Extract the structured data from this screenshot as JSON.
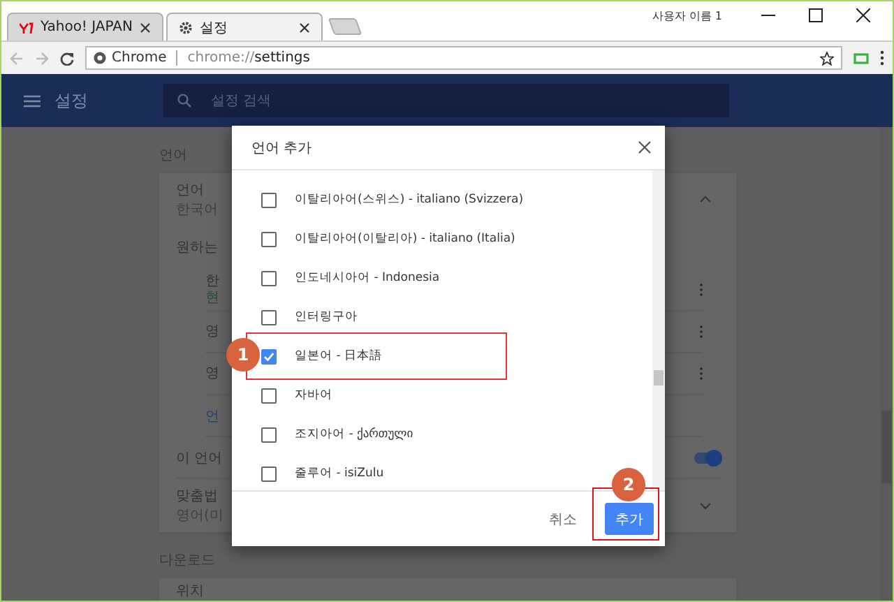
{
  "window": {
    "profile": "사용자 이름 1"
  },
  "tabs": [
    {
      "title": "Yahoo! JAPAN",
      "selected": false
    },
    {
      "title": "설정",
      "selected": true
    }
  ],
  "address_bar": {
    "site": "Chrome",
    "url_scheme": "chrome://",
    "url_path": "settings"
  },
  "header": {
    "title": "설정",
    "search_placeholder": "설정 검색"
  },
  "sections": [
    {
      "title": "언어",
      "rows": [
        {
          "kind": "expander",
          "title": "언어",
          "subtitle": "한국어",
          "expanded": true
        },
        {
          "kind": "prompt",
          "title": "원하는"
        },
        {
          "kind": "language",
          "title": "한",
          "note": "현"
        },
        {
          "kind": "language",
          "title": "영"
        },
        {
          "kind": "language",
          "title": "영"
        },
        {
          "kind": "link",
          "title": "언"
        },
        {
          "kind": "toggle",
          "title": "이 언어",
          "on": true
        },
        {
          "kind": "expander",
          "title": "맞춤법",
          "subtitle": "영어(미",
          "expanded": false
        }
      ]
    },
    {
      "title": "다운로드",
      "rows": [
        {
          "kind": "plain",
          "title": "위치"
        }
      ]
    }
  ],
  "dialog": {
    "title": "언어 추가",
    "items": [
      {
        "label": "이탈리아어(스위스) - italiano (Svizzera)",
        "checked": false
      },
      {
        "label": "이탈리아어(이탈리아) - italiano (Italia)",
        "checked": false
      },
      {
        "label": "인도네시아어 - Indonesia",
        "checked": false
      },
      {
        "label": "인터링구아",
        "checked": false
      },
      {
        "label": "일본어 - 日本語",
        "checked": true
      },
      {
        "label": "자바어",
        "checked": false
      },
      {
        "label": "조지아어 - ქართული",
        "checked": false
      },
      {
        "label": "줄루어 - isiZulu",
        "checked": false
      }
    ],
    "buttons": [
      {
        "label": "취소",
        "kind": "text"
      },
      {
        "label": "추가",
        "kind": "primary"
      }
    ]
  },
  "annotations": [
    {
      "number": "1"
    },
    {
      "number": "2"
    }
  ]
}
